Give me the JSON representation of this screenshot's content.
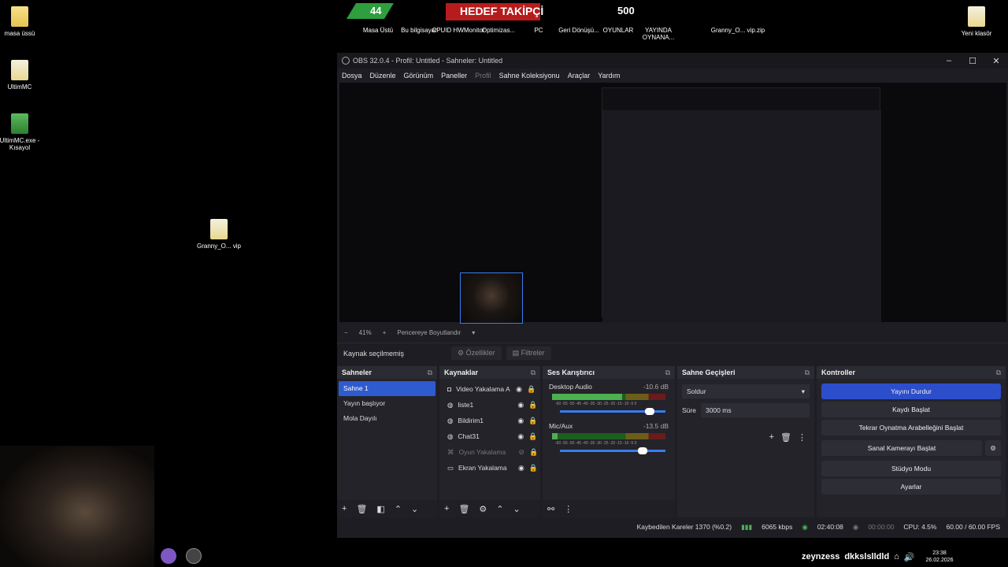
{
  "desktop": {
    "left_icons": [
      {
        "label": "masa üssü",
        "kind": "folder"
      },
      {
        "label": "UltimMC",
        "kind": "folder-doc"
      },
      {
        "label": "UltimMC.exe - Kısayol",
        "kind": "mc"
      }
    ],
    "mid_icon": {
      "label": "Granny_O... vip",
      "kind": "folder-doc"
    },
    "top_icons": [
      {
        "label": "Masa Üstü"
      },
      {
        "label": "Bu bilgisayar"
      },
      {
        "label": "CPUID HWMonitor"
      },
      {
        "label": "Optimizas..."
      },
      {
        "label": "PC"
      },
      {
        "label": "Geri Dönüşü..."
      },
      {
        "label": "OYUNLAR"
      },
      {
        "label": "YAYINDA OYNANA..."
      },
      {
        "label": "Granny_O... vip.zip"
      }
    ],
    "right_icon": {
      "label": "Yeni klasör"
    },
    "banner": {
      "text": "HEDEF TAKİPÇİ",
      "num_left": "44",
      "num_right": "500"
    }
  },
  "obs": {
    "title": "OBS 32.0.4 - Profil: Untitled - Sahneler: Untitled",
    "menu": [
      "Dosya",
      "Düzenle",
      "Görünüm",
      "Paneller",
      "Profil",
      "Sahne Koleksiyonu",
      "Araçlar",
      "Yardım"
    ],
    "zoom": {
      "minus": "−",
      "value": "41%",
      "plus": "+",
      "fit": "Pencereye Boyutlandır"
    },
    "source_bar": {
      "none_selected": "Kaynak seçilmemiş",
      "properties": "Özellikler",
      "filters": "Filtreler"
    },
    "scenes": {
      "title": "Sahneler",
      "items": [
        "Sahne 1",
        "Yayın başlıyor",
        "Mola Dayılı"
      ]
    },
    "sources": {
      "title": "Kaynaklar",
      "items": [
        {
          "name": "Video Yakalama A",
          "icon": "camera-icon",
          "hidden": false
        },
        {
          "name": "liste1",
          "icon": "globe-icon",
          "hidden": false
        },
        {
          "name": "Bildirim1",
          "icon": "globe-icon",
          "hidden": false
        },
        {
          "name": "Chat31",
          "icon": "globe-icon",
          "hidden": false
        },
        {
          "name": "Oyun Yakalama",
          "icon": "gamepad-icon",
          "hidden": true
        },
        {
          "name": "Ekran Yakalama",
          "icon": "monitor-icon",
          "hidden": false
        }
      ]
    },
    "mixer": {
      "title": "Ses Karıştırıcı",
      "channels": [
        {
          "name": "Desktop Audio",
          "db": "-10.6 dB",
          "level": 0.62,
          "volume": 0.85
        },
        {
          "name": "Mic/Aux",
          "db": "-13.5 dB",
          "level": 0.05,
          "volume": 0.78
        }
      ],
      "scale": "-60 -55 -50 -45 -40 -35 -30 -25 -20 -15 -10 -5 0"
    },
    "transitions": {
      "title": "Sahne Geçişleri",
      "type": "Soldur",
      "duration_label": "Süre",
      "duration_value": "3000 ms"
    },
    "controls": {
      "title": "Kontroller",
      "buttons": [
        "Yayını Durdur",
        "Kaydı Başlat",
        "Tekrar Oynatma Arabelleğini Başlat",
        "Sanal Kamerayı Başlat",
        "Stüdyo Modu",
        "Ayarlar"
      ]
    },
    "status": {
      "dropped": "Kaybedilen Kareler 1370 (%0.2)",
      "bitrate": "6065 kbps",
      "stream_time": "02:40:08",
      "rec_time": "00:00:00",
      "cpu": "CPU: 4.5%",
      "fps": "60.00 / 60.00 FPS"
    }
  },
  "tray": {
    "brand": "zeynzess",
    "handle": "dkkslslldld",
    "time": "23:38",
    "date": "26.02.2026"
  },
  "colors": {
    "accent": "#2f5bd0",
    "obs_bg": "#1d1d23",
    "dock_bg": "#232329"
  }
}
